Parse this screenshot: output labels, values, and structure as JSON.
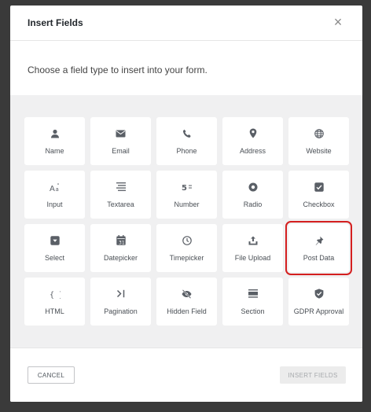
{
  "modal": {
    "title": "Insert Fields",
    "close_glyph": "×",
    "intro": "Choose a field type to insert into your form.",
    "fields": [
      {
        "label": "Name",
        "icon": "user-icon"
      },
      {
        "label": "Email",
        "icon": "envelope-icon"
      },
      {
        "label": "Phone",
        "icon": "phone-icon"
      },
      {
        "label": "Address",
        "icon": "map-pin-icon"
      },
      {
        "label": "Website",
        "icon": "globe-icon"
      },
      {
        "label": "Input",
        "icon": "text-size-icon"
      },
      {
        "label": "Textarea",
        "icon": "text-lines-icon"
      },
      {
        "label": "Number",
        "icon": "number-icon"
      },
      {
        "label": "Radio",
        "icon": "radio-icon"
      },
      {
        "label": "Checkbox",
        "icon": "checkbox-icon"
      },
      {
        "label": "Select",
        "icon": "dropdown-icon"
      },
      {
        "label": "Datepicker",
        "icon": "calendar-icon"
      },
      {
        "label": "Timepicker",
        "icon": "clock-icon"
      },
      {
        "label": "File Upload",
        "icon": "upload-icon"
      },
      {
        "label": "Post Data",
        "icon": "pushpin-icon",
        "highlighted": true
      },
      {
        "label": "HTML",
        "icon": "braces-icon"
      },
      {
        "label": "Pagination",
        "icon": "pagination-icon"
      },
      {
        "label": "Hidden Field",
        "icon": "eye-slash-icon"
      },
      {
        "label": "Section",
        "icon": "section-icon"
      },
      {
        "label": "GDPR Approval",
        "icon": "shield-check-icon"
      }
    ],
    "cancel_label": "CANCEL",
    "insert_label": "INSERT FIELDS",
    "highlight_color": "#d41f1f"
  }
}
